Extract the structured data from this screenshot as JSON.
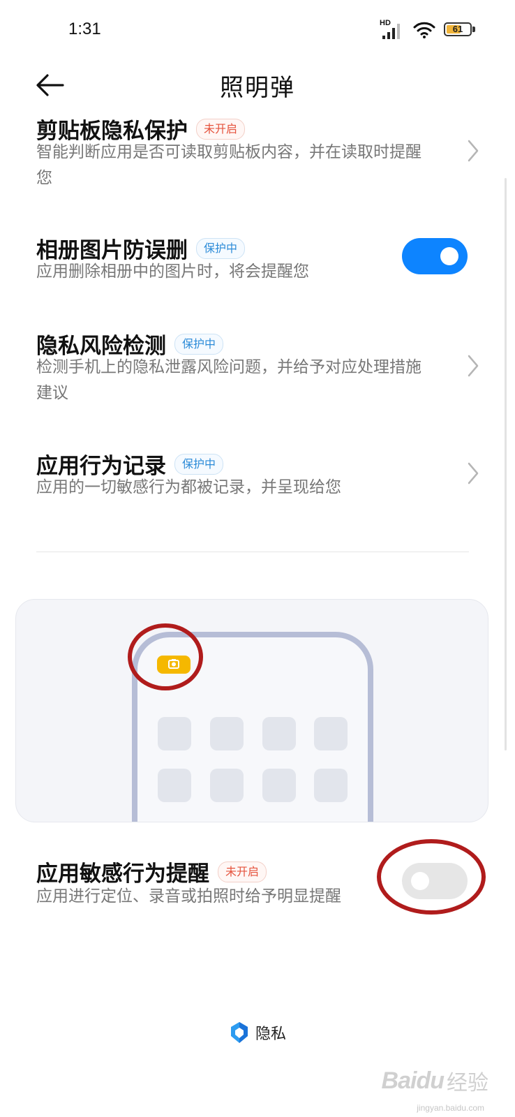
{
  "status_bar": {
    "time": "1:31",
    "network_label": "HD",
    "battery_level": "61",
    "battery_fraction": 0.61
  },
  "header": {
    "title": "照明弹",
    "back_icon": "arrow-left-icon"
  },
  "settings": [
    {
      "title": "剪贴板隐私保护",
      "badge": "未开启",
      "badge_state": "off",
      "description": "智能判断应用是否可读取剪贴板内容，并在读取时提醒您",
      "control": "chevron-right-icon"
    },
    {
      "title": "相册图片防误删",
      "badge": "保护中",
      "badge_state": "on",
      "description": "应用删除相册中的图片时，将会提醒您",
      "control": "toggle",
      "toggle_on": true
    },
    {
      "title": "隐私风险检测",
      "badge": "保护中",
      "badge_state": "on",
      "description": "检测手机上的隐私泄露风险问题，并给予对应处理措施建议",
      "control": "chevron-right-icon"
    },
    {
      "title": "应用行为记录",
      "badge": "保护中",
      "badge_state": "on",
      "description": "应用的一切敏感行为都被记录，并呈现给您",
      "control": "chevron-right-icon"
    }
  ],
  "illustration": {
    "icon": "camera-icon",
    "indicator_color": "#f5b800"
  },
  "sensitive_reminder": {
    "title": "应用敏感行为提醒",
    "badge": "未开启",
    "badge_state": "off",
    "description": "应用进行定位、录音或拍照时给予明显提醒",
    "toggle_on": false
  },
  "footer": {
    "brand_icon": "privacy-shield-icon",
    "brand_name": "隐私"
  },
  "watermark": {
    "logo": "Baidu",
    "text": "经验",
    "url": "jingyan.baidu.com"
  },
  "colors": {
    "accent": "#0d84ff",
    "badge_off": "#e5533d",
    "badge_on": "#2c8bd8",
    "annotation": "#b01c1c"
  }
}
